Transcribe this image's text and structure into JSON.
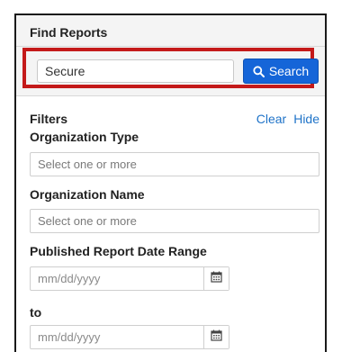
{
  "find_reports": {
    "title": "Find Reports",
    "search_value": "Secure",
    "search_button_label": "Search",
    "highlight_color": "#c41a1a",
    "button_color": "#1565d8"
  },
  "filters": {
    "title": "Filters",
    "clear_label": "Clear",
    "hide_label": "Hide",
    "organization_type": {
      "label": "Organization Type",
      "placeholder": "Select one or more"
    },
    "organization_name": {
      "label": "Organization Name",
      "placeholder": "Select one or more"
    },
    "date_range": {
      "label": "Published Report Date Range",
      "from_placeholder": "mm/dd/yyyy",
      "to_label": "to",
      "to_placeholder": "mm/dd/yyyy"
    }
  },
  "icons": {
    "search": "search-icon",
    "calendar": "calendar-icon"
  },
  "link_color": "#1f73c8"
}
